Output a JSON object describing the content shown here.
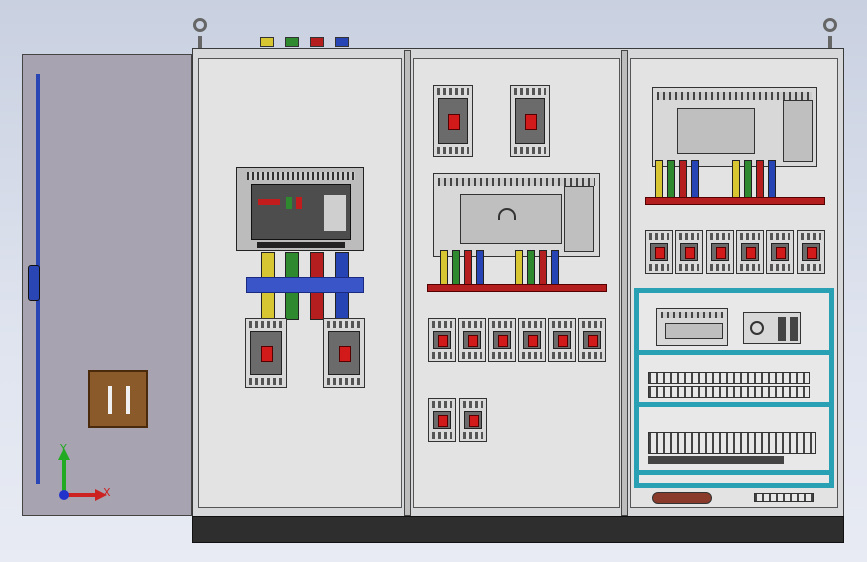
{
  "axes": {
    "x_label": "X",
    "y_label": "Y"
  },
  "colors": {
    "phase_l1": "#d7c532",
    "phase_l2": "#2f8a2f",
    "phase_l3": "#b41e1e",
    "neutral": "#2744b4",
    "mount_panel": "#e3e3e3",
    "cabinet": "#d6d8da",
    "door": "#a8a3b0",
    "plc_frame": "#2aa0b4"
  },
  "icons": {
    "eyebolt": "circle-ring",
    "triad": "xyz-axis-arrows"
  }
}
